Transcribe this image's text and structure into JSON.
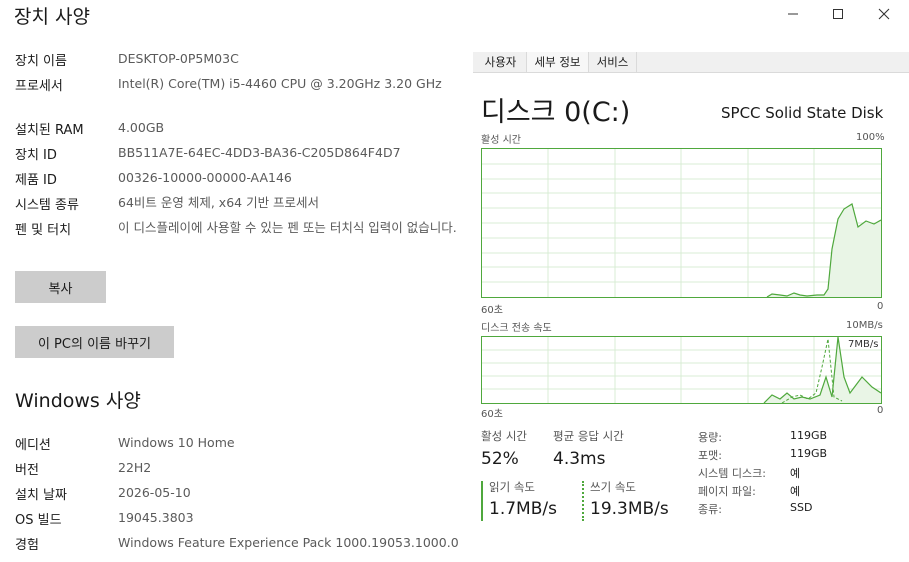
{
  "window": {
    "title": "장치 사양",
    "minimize_icon": "minimize-icon",
    "maximize_icon": "maximize-icon",
    "close_icon": "close-icon"
  },
  "device_specs": {
    "rows": [
      {
        "label": "장치 이름",
        "value": "DESKTOP-0P5M03C"
      },
      {
        "label": "프로세서",
        "value": "Intel(R) Core(TM) i5-4460 CPU @ 3.20GHz 3.20 GHz"
      },
      {
        "label": "설치된 RAM",
        "value": "4.00GB"
      },
      {
        "label": "장치 ID",
        "value": "BB511A7E-64EC-4DD3-BA36-C205D864F4D7"
      },
      {
        "label": "제품 ID",
        "value": "00326-10000-00000-AA146"
      },
      {
        "label": "시스템 종류",
        "value": "64비트 운영 체제, x64 기반 프로세서"
      },
      {
        "label": "펜 및 터치",
        "value": "이 디스플레이에 사용할 수 있는 펜 또는 터치식 입력이 없습니다."
      }
    ],
    "copy_button": "복사",
    "rename_button": "이 PC의 이름 바꾸기"
  },
  "windows_specs": {
    "heading": "Windows 사양",
    "rows": [
      {
        "label": "에디션",
        "value": "Windows 10 Home"
      },
      {
        "label": "버전",
        "value": "22H2"
      },
      {
        "label": "설치 날짜",
        "value": "2026-05-10"
      },
      {
        "label": "OS 빌드",
        "value": "19045.3803"
      },
      {
        "label": "경험",
        "value": "Windows Feature Experience Pack 1000.19053.1000.0"
      }
    ]
  },
  "task_manager": {
    "tabs": [
      "사용자",
      "세부 정보",
      "서비스"
    ],
    "disk_title": "디스크 0(C:)",
    "disk_model": "SPCC Solid State Disk",
    "active_time_graph": {
      "label": "활성 시간",
      "max_label": "100%",
      "x_left": "60초",
      "x_right": "0"
    },
    "transfer_graph": {
      "label": "디스크 전송 속도",
      "max_label": "10MB/s",
      "inner_label": "7MB/s",
      "x_left": "60초",
      "x_right": "0"
    },
    "stats": {
      "active_time_label": "활성 시간",
      "active_time_value": "52%",
      "avg_response_label": "평균 응답 시간",
      "avg_response_value": "4.3ms",
      "read_label": "읽기 속도",
      "read_value": "1.7MB/s",
      "write_label": "쓰기 속도",
      "write_value": "19.3MB/s"
    },
    "properties": [
      {
        "key": "용량:",
        "value": "119GB"
      },
      {
        "key": "포맷:",
        "value": "119GB"
      },
      {
        "key": "시스템 디스크:",
        "value": "예"
      },
      {
        "key": "페이지 파일:",
        "value": "예"
      },
      {
        "key": "종류:",
        "value": "SSD"
      }
    ],
    "colors": {
      "graph_line": "#4fa83d",
      "graph_fill": "#e9f5e6",
      "grid": "#d9ecd4"
    }
  }
}
